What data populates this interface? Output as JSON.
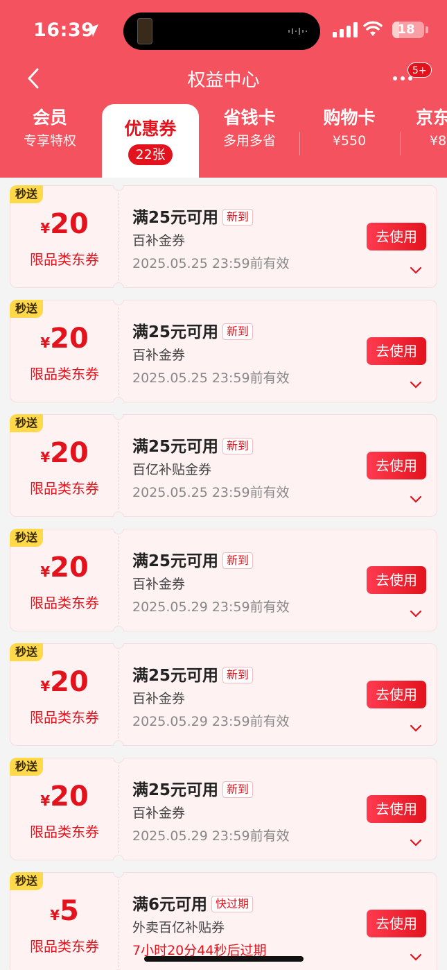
{
  "status_bar": {
    "time": "16:39",
    "battery": "18"
  },
  "nav": {
    "title": "权益中心",
    "badge": "5+"
  },
  "tabs": [
    {
      "title": "会员",
      "sub": "专享特权"
    },
    {
      "title": "优惠券",
      "sub": "22张"
    },
    {
      "title": "省钱卡",
      "sub": "多用多省"
    },
    {
      "title": "购物卡",
      "sub": "¥550"
    },
    {
      "title": "京东",
      "sub": "¥8"
    }
  ],
  "coupons": [
    {
      "tag": "秒送",
      "currency": "¥",
      "amount": "20",
      "type": "限品类东券",
      "condition": "满25元可用",
      "badge": "新到",
      "name": "百补金券",
      "expiry": "2025.05.25 23:59前有效",
      "button": "去使用"
    },
    {
      "tag": "秒送",
      "currency": "¥",
      "amount": "20",
      "type": "限品类东券",
      "condition": "满25元可用",
      "badge": "新到",
      "name": "百补金券",
      "expiry": "2025.05.25 23:59前有效",
      "button": "去使用"
    },
    {
      "tag": "秒送",
      "currency": "¥",
      "amount": "20",
      "type": "限品类东券",
      "condition": "满25元可用",
      "badge": "新到",
      "name": "百亿补贴金券",
      "expiry": "2025.05.25 23:59前有效",
      "button": "去使用"
    },
    {
      "tag": "秒送",
      "currency": "¥",
      "amount": "20",
      "type": "限品类东券",
      "condition": "满25元可用",
      "badge": "新到",
      "name": "百补金券",
      "expiry": "2025.05.29 23:59前有效",
      "button": "去使用"
    },
    {
      "tag": "秒送",
      "currency": "¥",
      "amount": "20",
      "type": "限品类东券",
      "condition": "满25元可用",
      "badge": "新到",
      "name": "百补金券",
      "expiry": "2025.05.29 23:59前有效",
      "button": "去使用"
    },
    {
      "tag": "秒送",
      "currency": "¥",
      "amount": "20",
      "type": "限品类东券",
      "condition": "满25元可用",
      "badge": "新到",
      "name": "百补金券",
      "expiry": "2025.05.29 23:59前有效",
      "button": "去使用"
    },
    {
      "tag": "秒送",
      "currency": "¥",
      "amount": "5",
      "type": "限品类东券",
      "condition": "满6元可用",
      "badge": "快过期",
      "name": "外卖百亿补贴券",
      "expiry": "7小时20分44秒后过期",
      "button": "去使用",
      "expiry_urgent": true
    }
  ],
  "colors": {
    "brand_red": "#e2131d",
    "header_bg": "#f4525e",
    "tag_yellow": "#ffd94a"
  }
}
